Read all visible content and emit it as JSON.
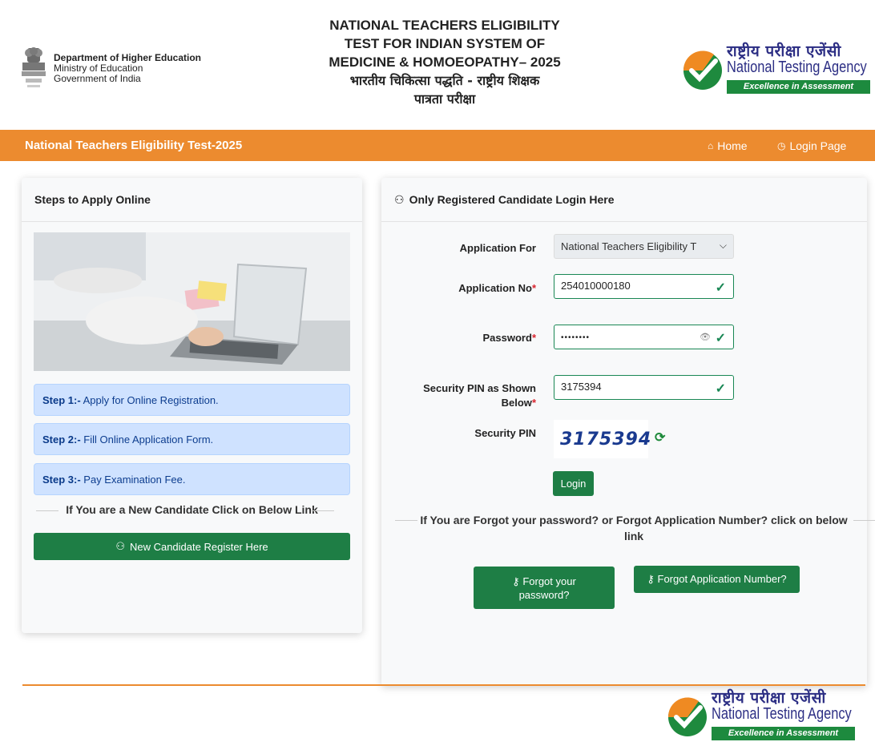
{
  "header": {
    "dept_line1": "Department of Higher Education",
    "dept_line2": "Ministry of Education",
    "dept_line3": "Government of India",
    "title_line1": "NATIONAL TEACHERS ELIGIBILITY",
    "title_line2": "TEST FOR INDIAN SYSTEM OF",
    "title_line3": "MEDICINE & HOMOEOPATHY– 2025",
    "title_line4": "भारतीय चिकित्सा पद्धति - राष्ट्रीय शिक्षक",
    "title_line5": "पात्रता परीक्षा",
    "nta_hindi": "राष्ट्रीय परीक्षा एजेंसी",
    "nta_english": "National Testing Agency",
    "nta_tagline": "Excellence in Assessment"
  },
  "navbar": {
    "title": "National Teachers Eligibility Test-2025",
    "home": "Home",
    "login_page": "Login Page",
    "color": "#ec8b2f"
  },
  "left_card": {
    "heading": "Steps to Apply Online",
    "steps": [
      {
        "label": "Step 1:-",
        "text": "Apply for Online Registration."
      },
      {
        "label": "Step 2:-",
        "text": "Fill Online Application Form."
      },
      {
        "label": "Step 3:-",
        "text": "Pay Examination Fee."
      }
    ],
    "new_candidate_text": "If You are a New Candidate Click on Below Link",
    "register_button": "New Candidate Register Here"
  },
  "login_card": {
    "heading": "Only Registered Candidate Login Here",
    "application_for_label": "Application For",
    "application_for_value": "National Teachers Eligibility T",
    "application_no_label": "Application No",
    "application_no_value": "254010000180",
    "password_label": "Password",
    "password_value": "••••••••",
    "security_pin_label_1": "Security PIN as Shown",
    "security_pin_label_2": "Below",
    "security_pin_value": "3175394",
    "captcha_label": "Security PIN",
    "captcha_text": "3175394",
    "login_button": "Login",
    "forgot_text": "If You are Forgot your password? or Forgot Application Number? click on below link",
    "forgot_password_button_1": "Forgot your",
    "forgot_password_button_2": "password?",
    "forgot_app_button": "Forgot Application Number?",
    "required_mark": "*",
    "green": "#1e7e45"
  }
}
